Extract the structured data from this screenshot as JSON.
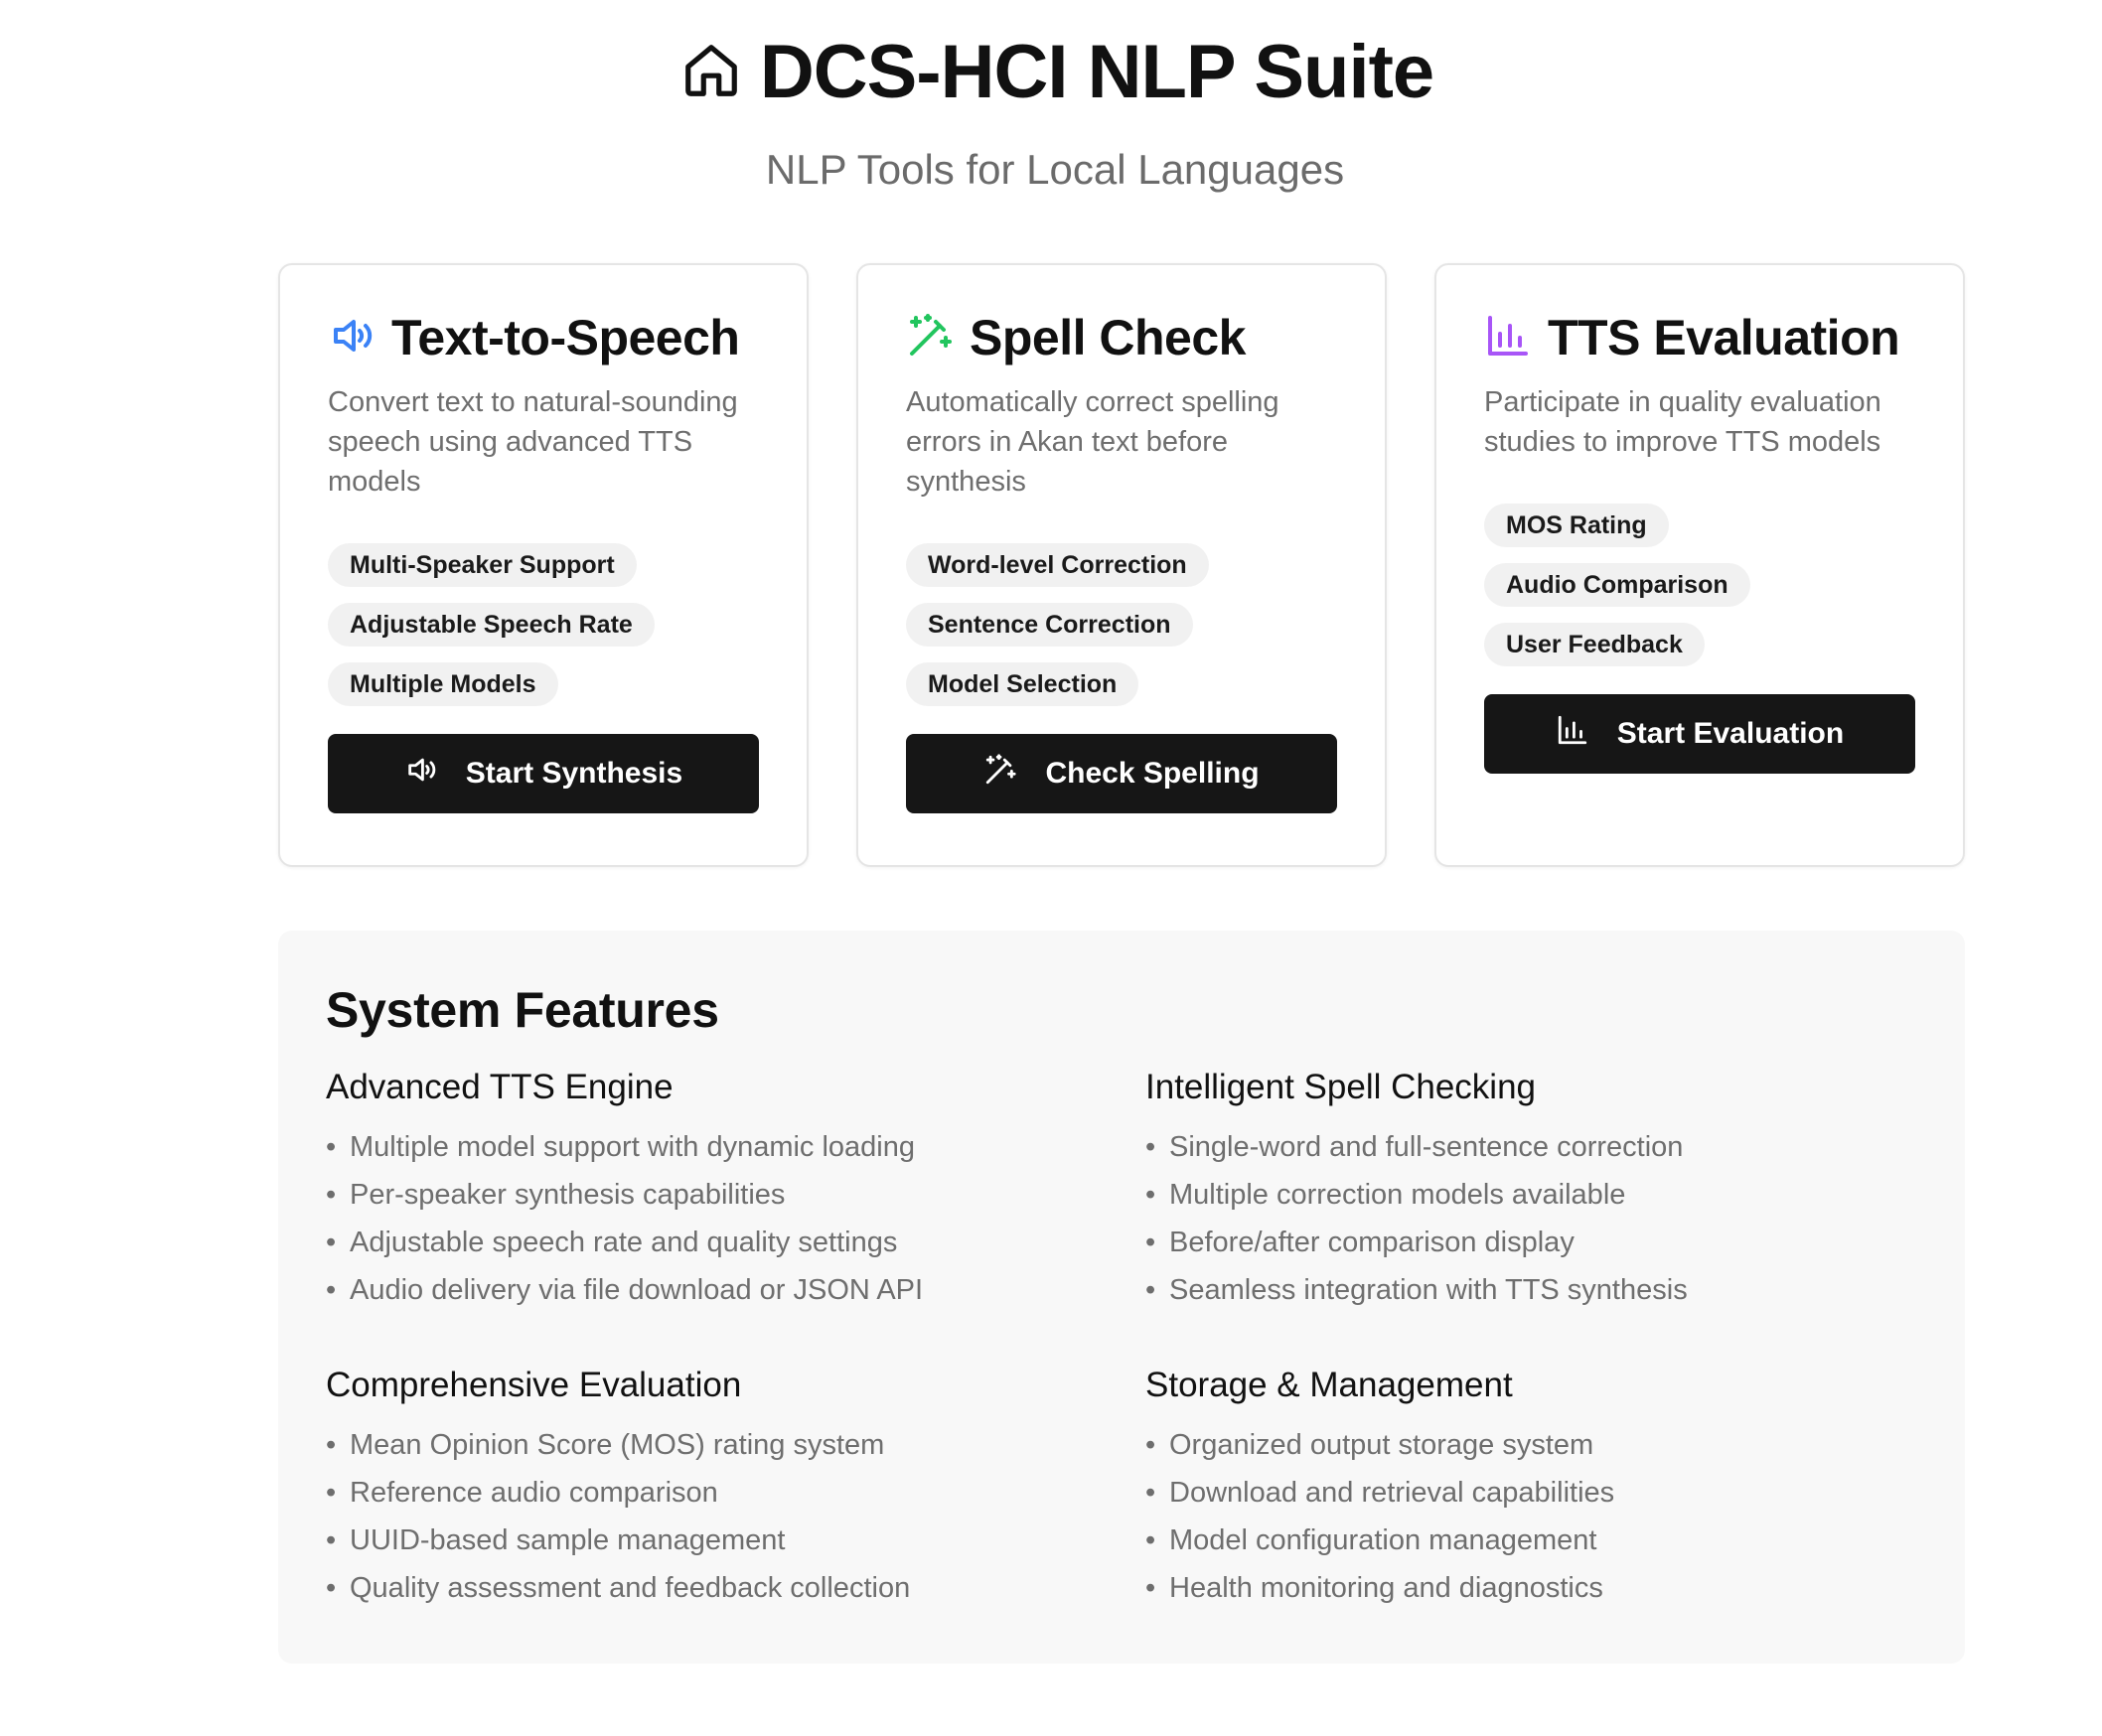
{
  "header": {
    "title": "DCS-HCI NLP Suite",
    "subtitle": "NLP Tools for Local Languages",
    "icon": "home-icon"
  },
  "cards": [
    {
      "title": "Text-to-Speech",
      "icon": "speaker-icon",
      "icon_color": "#3b82f6",
      "description": "Convert text to natural-sounding speech using advanced TTS models",
      "tags": [
        "Multi-Speaker Support",
        "Adjustable Speech Rate",
        "Multiple Models"
      ],
      "button": {
        "label": "Start Synthesis",
        "icon": "speaker-icon"
      }
    },
    {
      "title": "Spell Check",
      "icon": "magic-wand-icon",
      "icon_color": "#22c55e",
      "description": "Automatically correct spelling errors in Akan text before synthesis",
      "tags": [
        "Word-level Correction",
        "Sentence Correction",
        "Model Selection"
      ],
      "button": {
        "label": "Check Spelling",
        "icon": "magic-wand-icon"
      }
    },
    {
      "title": "TTS Evaluation",
      "icon": "bar-chart-icon",
      "icon_color": "#a855f7",
      "description": "Participate in quality evaluation studies to improve TTS models",
      "tags": [
        "MOS Rating",
        "Audio Comparison",
        "User Feedback"
      ],
      "button": {
        "label": "Start Evaluation",
        "icon": "bar-chart-icon"
      }
    }
  ],
  "features": {
    "title": "System Features",
    "bullet": "•",
    "sections": [
      {
        "heading": "Advanced TTS Engine",
        "items": [
          "Multiple model support with dynamic loading",
          "Per-speaker synthesis capabilities",
          "Adjustable speech rate and quality settings",
          "Audio delivery via file download or JSON API"
        ]
      },
      {
        "heading": "Intelligent Spell Checking",
        "items": [
          "Single-word and full-sentence correction",
          "Multiple correction models available",
          "Before/after comparison display",
          "Seamless integration with TTS synthesis"
        ]
      },
      {
        "heading": "Comprehensive Evaluation",
        "items": [
          "Mean Opinion Score (MOS) rating system",
          "Reference audio comparison",
          "UUID-based sample management",
          "Quality assessment and feedback collection"
        ]
      },
      {
        "heading": "Storage & Management",
        "items": [
          "Organized output storage system",
          "Download and retrieval capabilities",
          "Model configuration management",
          "Health monitoring and diagnostics"
        ]
      }
    ]
  }
}
